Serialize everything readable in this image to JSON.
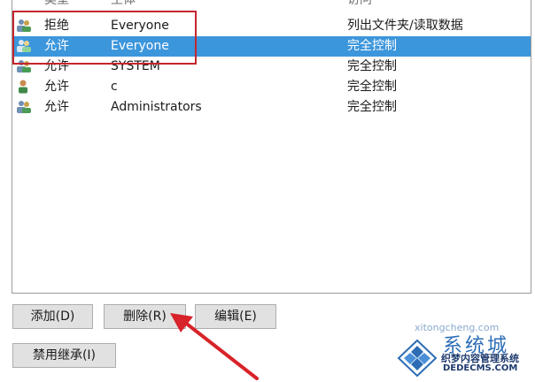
{
  "columns": {
    "type": "类型",
    "principal": "主体",
    "access": "访问"
  },
  "entries": [
    {
      "icon": "user-group-icon",
      "type": "拒绝",
      "principal": "Everyone",
      "access": "列出文件夹/读取数据",
      "selected": false
    },
    {
      "icon": "user-group-icon",
      "type": "允许",
      "principal": "Everyone",
      "access": "完全控制",
      "selected": true
    },
    {
      "icon": "user-group-icon",
      "type": "允许",
      "principal": "SYSTEM",
      "access": "完全控制",
      "selected": false
    },
    {
      "icon": "user-icon",
      "type": "允许",
      "principal": "c",
      "access": "完全控制",
      "selected": false
    },
    {
      "icon": "user-group-icon",
      "type": "允许",
      "principal": "Administrators",
      "access": "完全控制",
      "selected": false
    }
  ],
  "buttons": {
    "add": "添加(D)",
    "remove": "删除(R)",
    "edit": "编辑(E)",
    "disable_inheritance": "禁用继承(I)"
  },
  "watermark": {
    "brand": "系统城",
    "site_label": "xitongcheng.com",
    "cms_name": "织梦内容管理系统",
    "cms_domain": "DEDECMS.COM"
  },
  "colors": {
    "selection": "#3c96dc",
    "highlight_box": "#c4262e",
    "arrow": "#d8232a"
  }
}
